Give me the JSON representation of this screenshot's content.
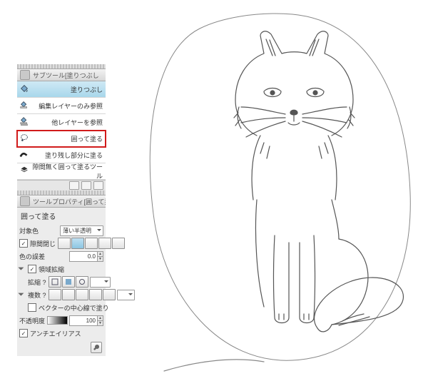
{
  "subtool_panel": {
    "title": "サブツール[塗りつぶし",
    "items": [
      {
        "label": "塗りつぶし",
        "selected": true,
        "highlighted": false,
        "icon": "bucket"
      },
      {
        "label": "編集レイヤーのみ参照",
        "selected": false,
        "highlighted": false,
        "icon": "bucket-layer"
      },
      {
        "label": "他レイヤーを参照",
        "selected": false,
        "highlighted": false,
        "icon": "bucket-layers"
      },
      {
        "label": "囲って塗る",
        "selected": false,
        "highlighted": true,
        "icon": "lasso-fill"
      },
      {
        "label": "塗り残し部分に塗る",
        "selected": false,
        "highlighted": false,
        "icon": "brush-gap"
      },
      {
        "label": "隙間無く囲って塗るツール",
        "selected": false,
        "highlighted": false,
        "icon": "sealed-fill"
      }
    ]
  },
  "property_panel": {
    "title": "ツールプロパティ[囲って塗",
    "tool_name": "囲って塗る",
    "rows": {
      "target_color": {
        "label": "対象色",
        "value": "薄い半透明"
      },
      "close_gap": {
        "label": "隙間閉じ",
        "checked": true,
        "level": 2
      },
      "color_margin": {
        "label": "色の誤差",
        "value": "0.0"
      },
      "area_scaling": {
        "label": "領域拡縮",
        "checked": true
      },
      "scaling": {
        "label": "拡縮  ?",
        "value": ""
      },
      "refer": {
        "label": "複数  ?"
      },
      "vector_center": {
        "label": "ベクターの中心線で塗り",
        "checked": false
      },
      "opacity": {
        "label": "不透明度",
        "value": "100"
      },
      "antialias": {
        "label": "アンチエイリアス",
        "checked": true
      }
    }
  }
}
